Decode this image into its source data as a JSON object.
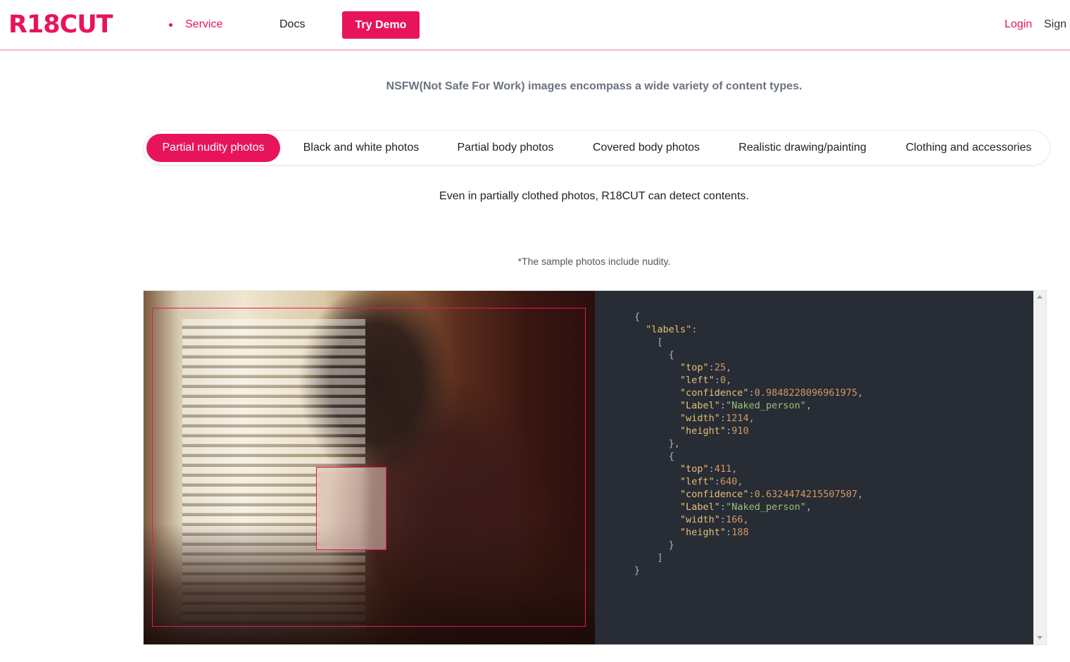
{
  "header": {
    "logo": "R18CUT",
    "nav": {
      "service": "Service",
      "docs": "Docs"
    },
    "try_demo": "Try Demo",
    "login": "Login",
    "sign": "Sign"
  },
  "intro": "NSFW(Not Safe For Work) images encompass a wide variety of content types.",
  "tabs": [
    {
      "label": "Partial nudity photos",
      "active": true
    },
    {
      "label": "Black and white photos",
      "active": false
    },
    {
      "label": "Partial body photos",
      "active": false
    },
    {
      "label": "Covered body photos",
      "active": false
    },
    {
      "label": "Realistic drawing/painting",
      "active": false
    },
    {
      "label": "Clothing and accessories",
      "active": false
    }
  ],
  "description": "Even in partially clothed photos, R18CUT can detect contents.",
  "note": "*The sample photos include nudity.",
  "result": {
    "labels_key": "labels",
    "labels": [
      {
        "top": "25",
        "left": "0",
        "confidence": "0.9848228096961975",
        "Label": "Naked_person",
        "width": "1214",
        "height": "910"
      },
      {
        "top": "411",
        "left": "640",
        "confidence": "0.6324474215507507",
        "Label": "Naked_person",
        "width": "166",
        "height": "188"
      }
    ]
  },
  "colors": {
    "accent": "#e8145b",
    "code_bg": "#282c34"
  }
}
